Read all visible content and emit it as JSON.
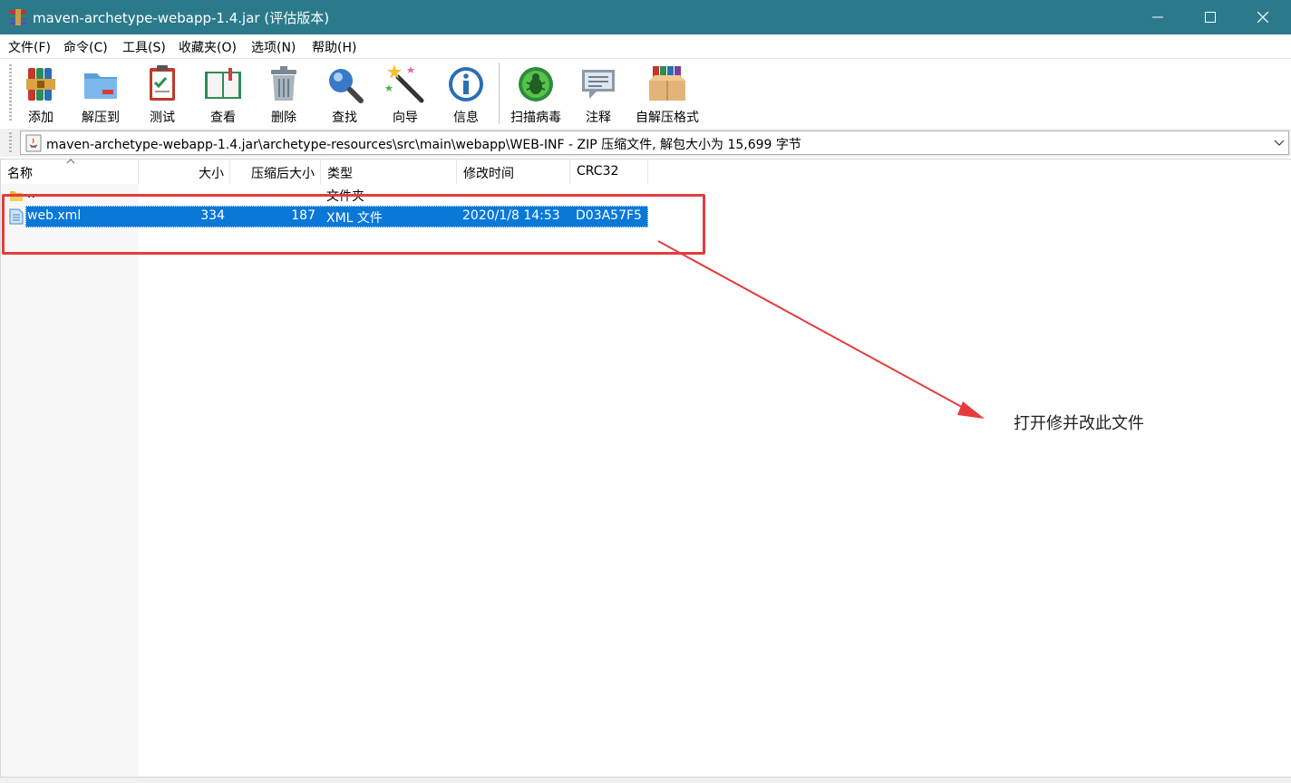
{
  "window": {
    "title": "maven-archetype-webapp-1.4.jar (评估版本)",
    "title_bar_color": "#2b7a8c"
  },
  "menu": [
    "文件(F)",
    "命令(C)",
    "工具(S)",
    "收藏夹(O)",
    "选项(N)",
    "帮助(H)"
  ],
  "toolbar": {
    "add": "添加",
    "extract_to": "解压到",
    "test": "测试",
    "view": "查看",
    "delete": "删除",
    "find": "查找",
    "wizard": "向导",
    "info": "信息",
    "virus_scan": "扫描病毒",
    "comment": "注释",
    "sfx": "自解压格式"
  },
  "address": {
    "path": "maven-archetype-webapp-1.4.jar\\archetype-resources\\src\\main\\webapp\\WEB-INF - ZIP 压缩文件, 解包大小为 15,699 字节"
  },
  "columns": {
    "name": "名称",
    "size": "大小",
    "packed": "压缩后大小",
    "type": "类型",
    "modified": "修改时间",
    "crc": "CRC32"
  },
  "rows": {
    "parent": {
      "name": "..",
      "type": "文件夹"
    },
    "file": {
      "name": "web.xml",
      "size": "334",
      "packed": "187",
      "type": "XML 文件",
      "modified": "2020/1/8 14:53",
      "crc": "D03A57F5"
    }
  },
  "annotation": {
    "text": "打开修并改此文件",
    "color": "#e43c3c"
  },
  "colors": {
    "selection": "#0a78d7"
  }
}
